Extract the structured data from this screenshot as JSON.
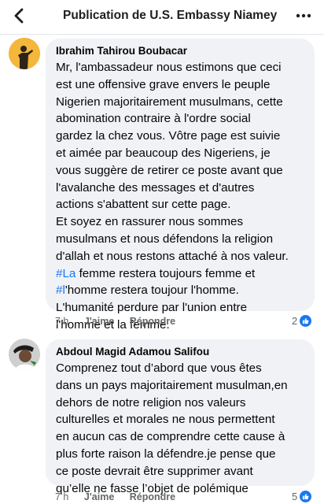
{
  "header": {
    "title": "Publication de U.S. Embassy Niamey",
    "back_icon": "chevron-left-icon",
    "more_icon": "more-horizontal-icon"
  },
  "comments": [
    {
      "author": "Ibrahim Tahirou Boubacar",
      "lines": [
        [
          {
            "t": "Mr, l'ambassadeur nous estimons que ceci"
          }
        ],
        [
          {
            "t": "est une offensive grave envers le peuple"
          }
        ],
        [
          {
            "t": "Nigerien majoritairement musulmans, cette"
          }
        ],
        [
          {
            "t": "abomination contraire à l'ordre social"
          }
        ],
        [
          {
            "t": "gardez la chez vous. Vôtre page est suivie"
          }
        ],
        [
          {
            "t": "et aimée par beaucoup des Nigeriens, je"
          }
        ],
        [
          {
            "t": "vous suggère de retirer ce poste avant que"
          }
        ],
        [
          {
            "t": "l'avalanche des messages et d'autres"
          }
        ],
        [
          {
            "t": "actions s'abattent sur cette page."
          }
        ],
        [
          {
            "t": "Et soyez en rassurer nous sommes"
          }
        ],
        [
          {
            "t": "musulmans et nous défendons la religion"
          }
        ],
        [
          {
            "t": "d'allah et nous restons attaché à nos valeur."
          }
        ],
        [
          {
            "t": "#La",
            "tag": true
          },
          {
            "t": " femme restera toujours femme et"
          }
        ],
        [
          {
            "t": "#l",
            "tag": true
          },
          {
            "t": "'homme restera toujour l'homme."
          }
        ],
        [
          {
            "t": "L'humanité perdure par l'union entre"
          }
        ],
        [
          {
            "t": "l'homme et la femme."
          }
        ]
      ],
      "time": "7 h",
      "like_label": "J'aime",
      "reply_label": "Répondre",
      "reaction_count": "2"
    },
    {
      "author": "Abdoul Magid Adamou Salifou",
      "lines": [
        [
          {
            "t": "Comprenez tout d’abord que vous êtes"
          }
        ],
        [
          {
            "t": "dans un pays majoritairement musulman,en"
          }
        ],
        [
          {
            "t": "dehors de notre religion nos valeurs"
          }
        ],
        [
          {
            "t": "culturelles et morales ne nous permettent"
          }
        ],
        [
          {
            "t": "en aucun cas de comprendre cette cause à"
          }
        ],
        [
          {
            "t": "plus forte raison la défendre.je pense que"
          }
        ],
        [
          {
            "t": "ce poste devrait être supprimer avant"
          }
        ],
        [
          {
            "t": "qu’elle ne fasse l’objet de polémique"
          }
        ]
      ],
      "time": "7 h",
      "like_label": "J'aime",
      "reply_label": "Répondre",
      "reaction_count": "5"
    }
  ],
  "colors": {
    "accent": "#1877f2",
    "bubble": "#f0f2f5",
    "secondary_text": "#65676b"
  }
}
